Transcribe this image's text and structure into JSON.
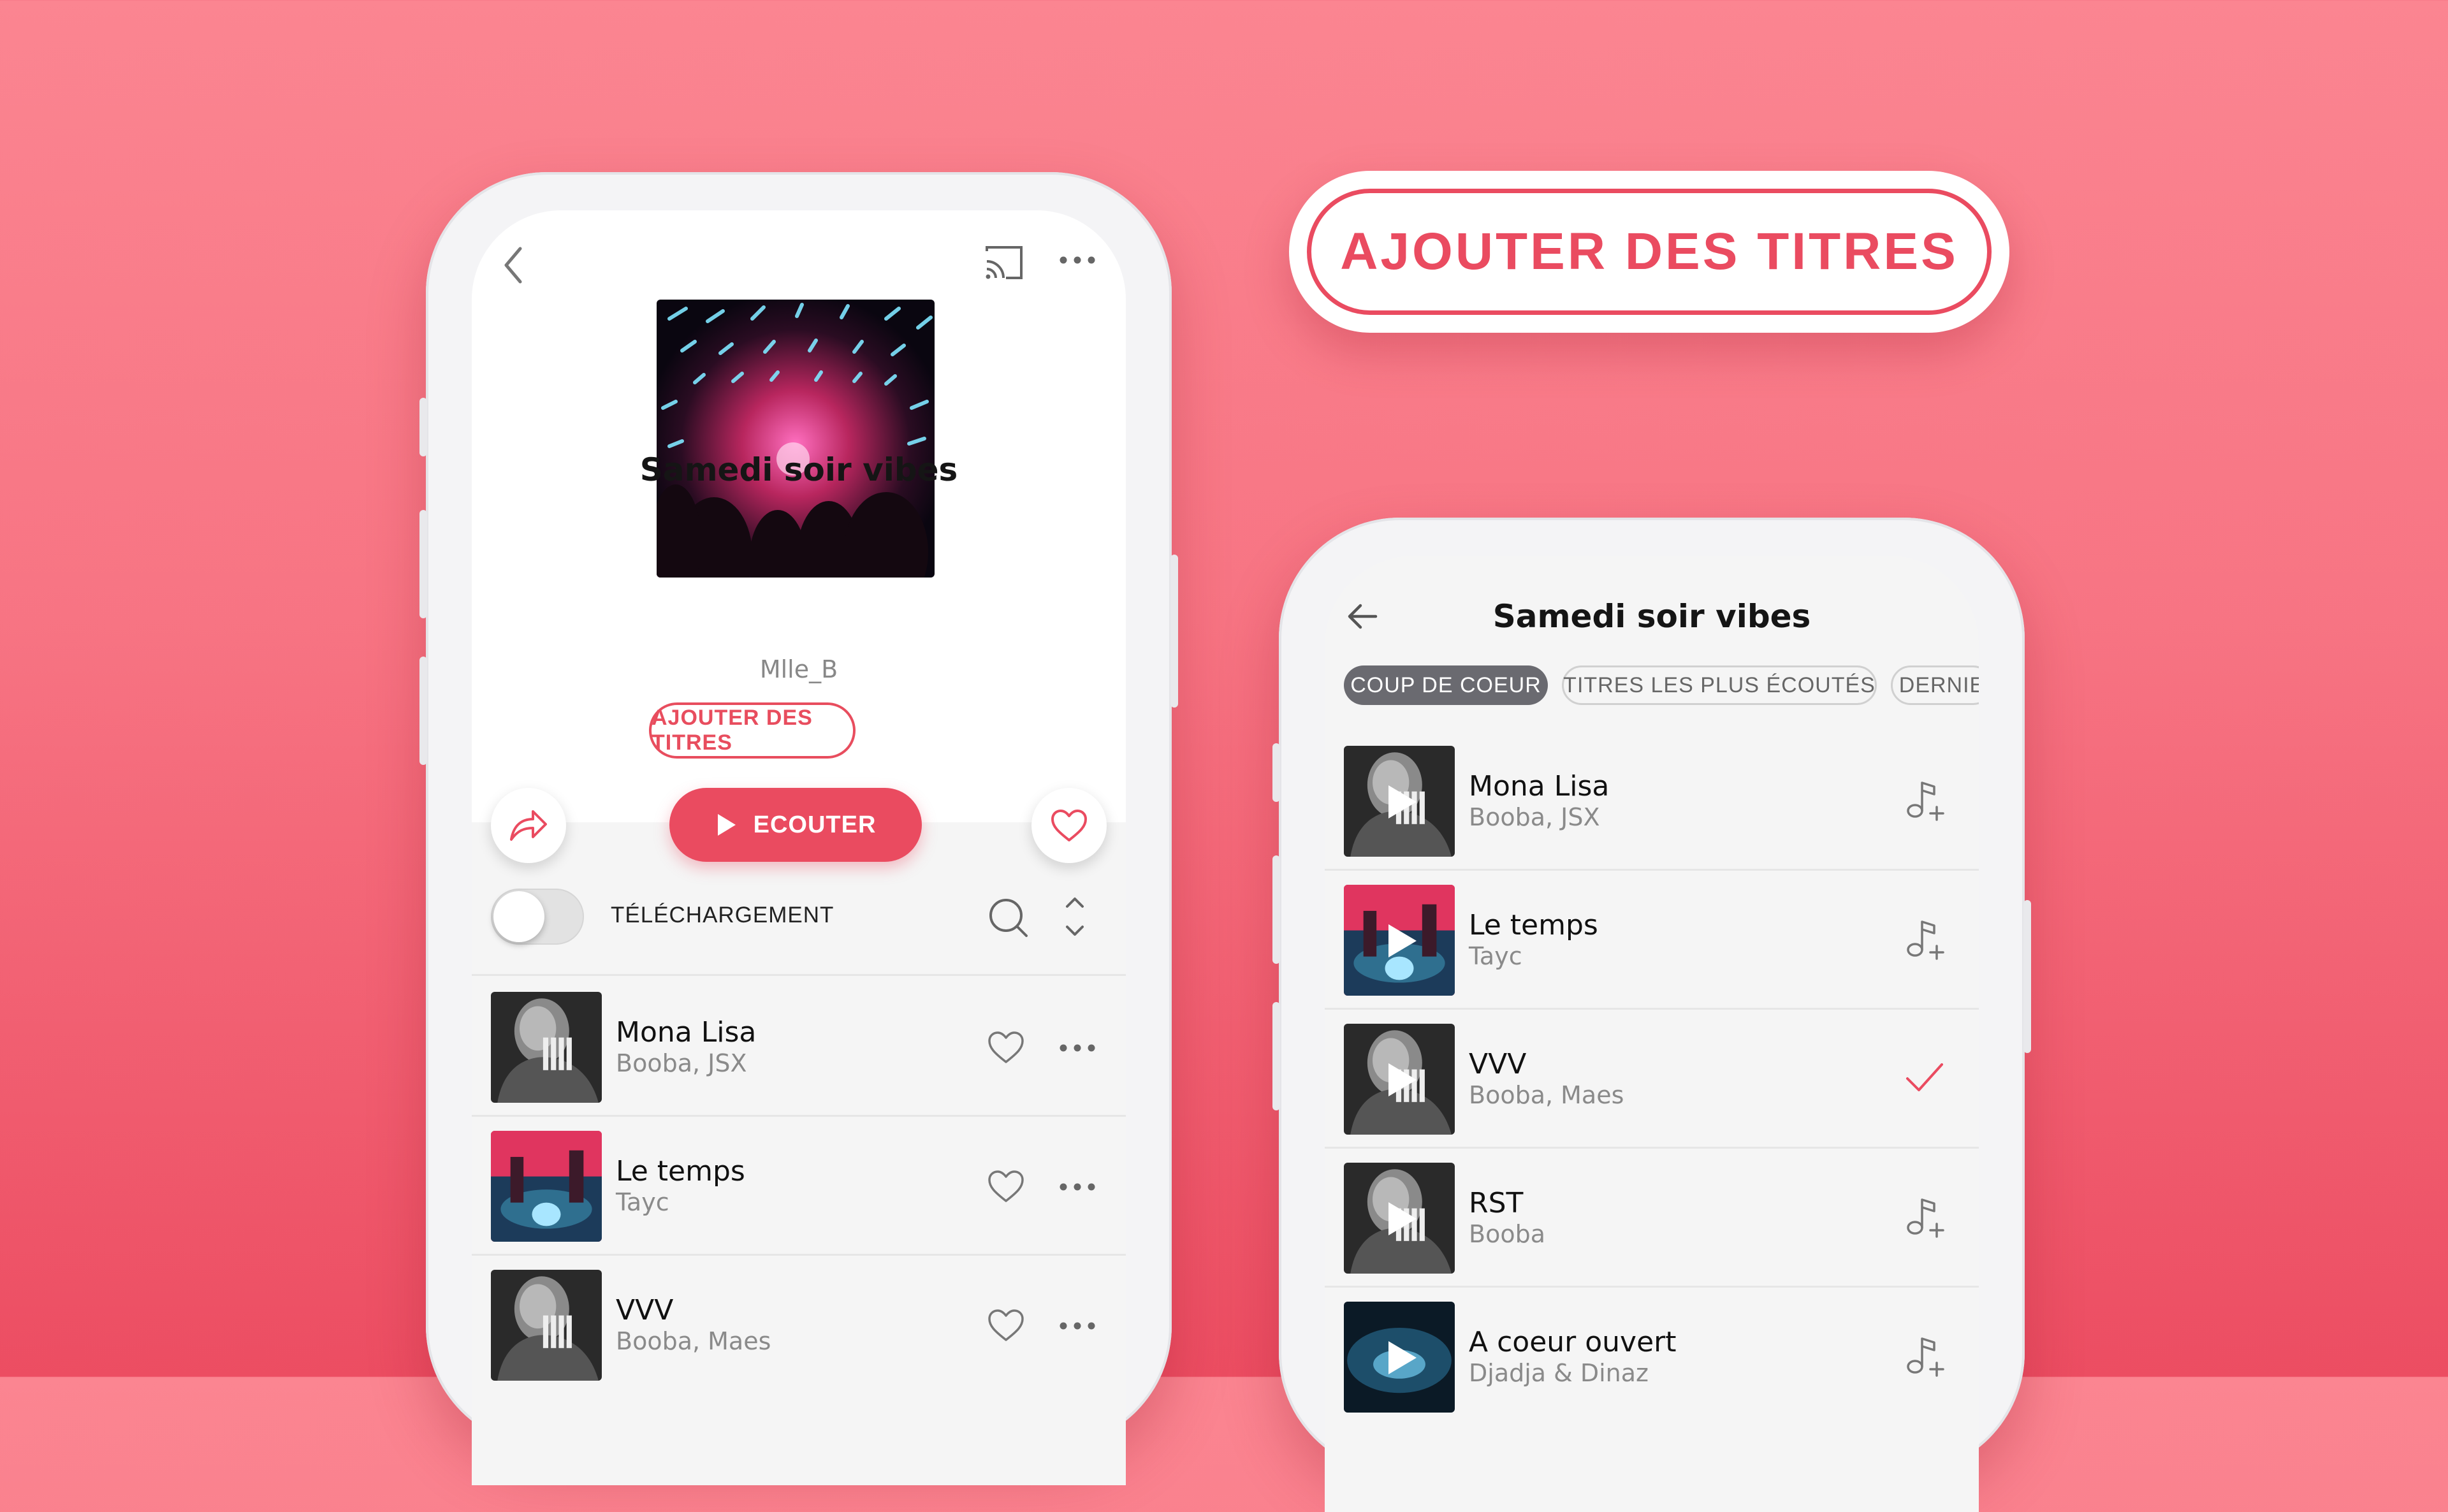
{
  "colors": {
    "accent": "#ea4b60",
    "background_top": "#fb8591",
    "background_bottom": "#ec4d62"
  },
  "promo": {
    "label": "AJOUTER DES TITRES"
  },
  "left_screen": {
    "icons": {
      "back": "chevron-left-icon",
      "cast": "cast-icon",
      "more": "more-horizontal-icon"
    },
    "playlist_title": "Samedi soir vibes",
    "owner": "Mlle_B",
    "add_tracks_label": "AJOUTER DES TITRES",
    "play_label": "ECOUTER",
    "download_label": "TÉLÉCHARGEMENT",
    "download_enabled": false,
    "tracks": [
      {
        "title": "Mona Lisa",
        "artists": "Booba, JSX",
        "cover": "bw"
      },
      {
        "title": "Le temps",
        "artists": "Tayc",
        "cover": "color"
      },
      {
        "title": "VVV",
        "artists": "Booba, Maes",
        "cover": "bw"
      }
    ]
  },
  "right_screen": {
    "title": "Samedi soir vibes",
    "chips": [
      {
        "label": "COUP DE COEUR",
        "active": true
      },
      {
        "label": "TITRES LES PLUS ÉCOUTÉS",
        "active": false
      },
      {
        "label": "DERNIE",
        "active": false
      }
    ],
    "tracks": [
      {
        "title": "Mona Lisa",
        "artists": "Booba, JSX",
        "state": "add",
        "cover": "bw"
      },
      {
        "title": "Le temps",
        "artists": "Tayc",
        "state": "add",
        "cover": "color"
      },
      {
        "title": "VVV",
        "artists": "Booba, Maes",
        "state": "added",
        "cover": "bw"
      },
      {
        "title": "RST",
        "artists": "Booba",
        "state": "add",
        "cover": "bw"
      },
      {
        "title": "A coeur ouvert",
        "artists": "Djadja & Dinaz",
        "state": "add",
        "cover": "dark"
      }
    ]
  }
}
